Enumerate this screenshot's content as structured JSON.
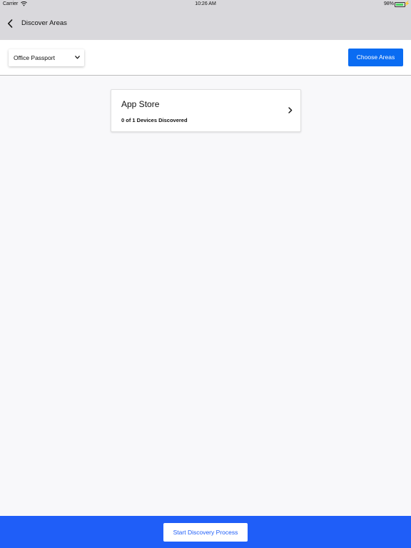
{
  "status_bar": {
    "carrier": "Carrier",
    "time": "10:26 AM",
    "battery": "98%"
  },
  "nav": {
    "back_icon": "chevron-left-icon",
    "title": "Discover Areas"
  },
  "toolbar": {
    "select_value": "Office Passport",
    "select_icon": "chevron-down-icon",
    "choose_label": "Choose Areas"
  },
  "areas": [
    {
      "name": "App Store",
      "status": "0 of 1 Devices Discovered"
    }
  ],
  "footer": {
    "start_label": "Start Discovery Process"
  },
  "colors": {
    "accent": "#0a6cf2",
    "footer": "#1f5ef8",
    "nav_background": "#d9d8dc",
    "page_background": "#f8f8fa"
  }
}
